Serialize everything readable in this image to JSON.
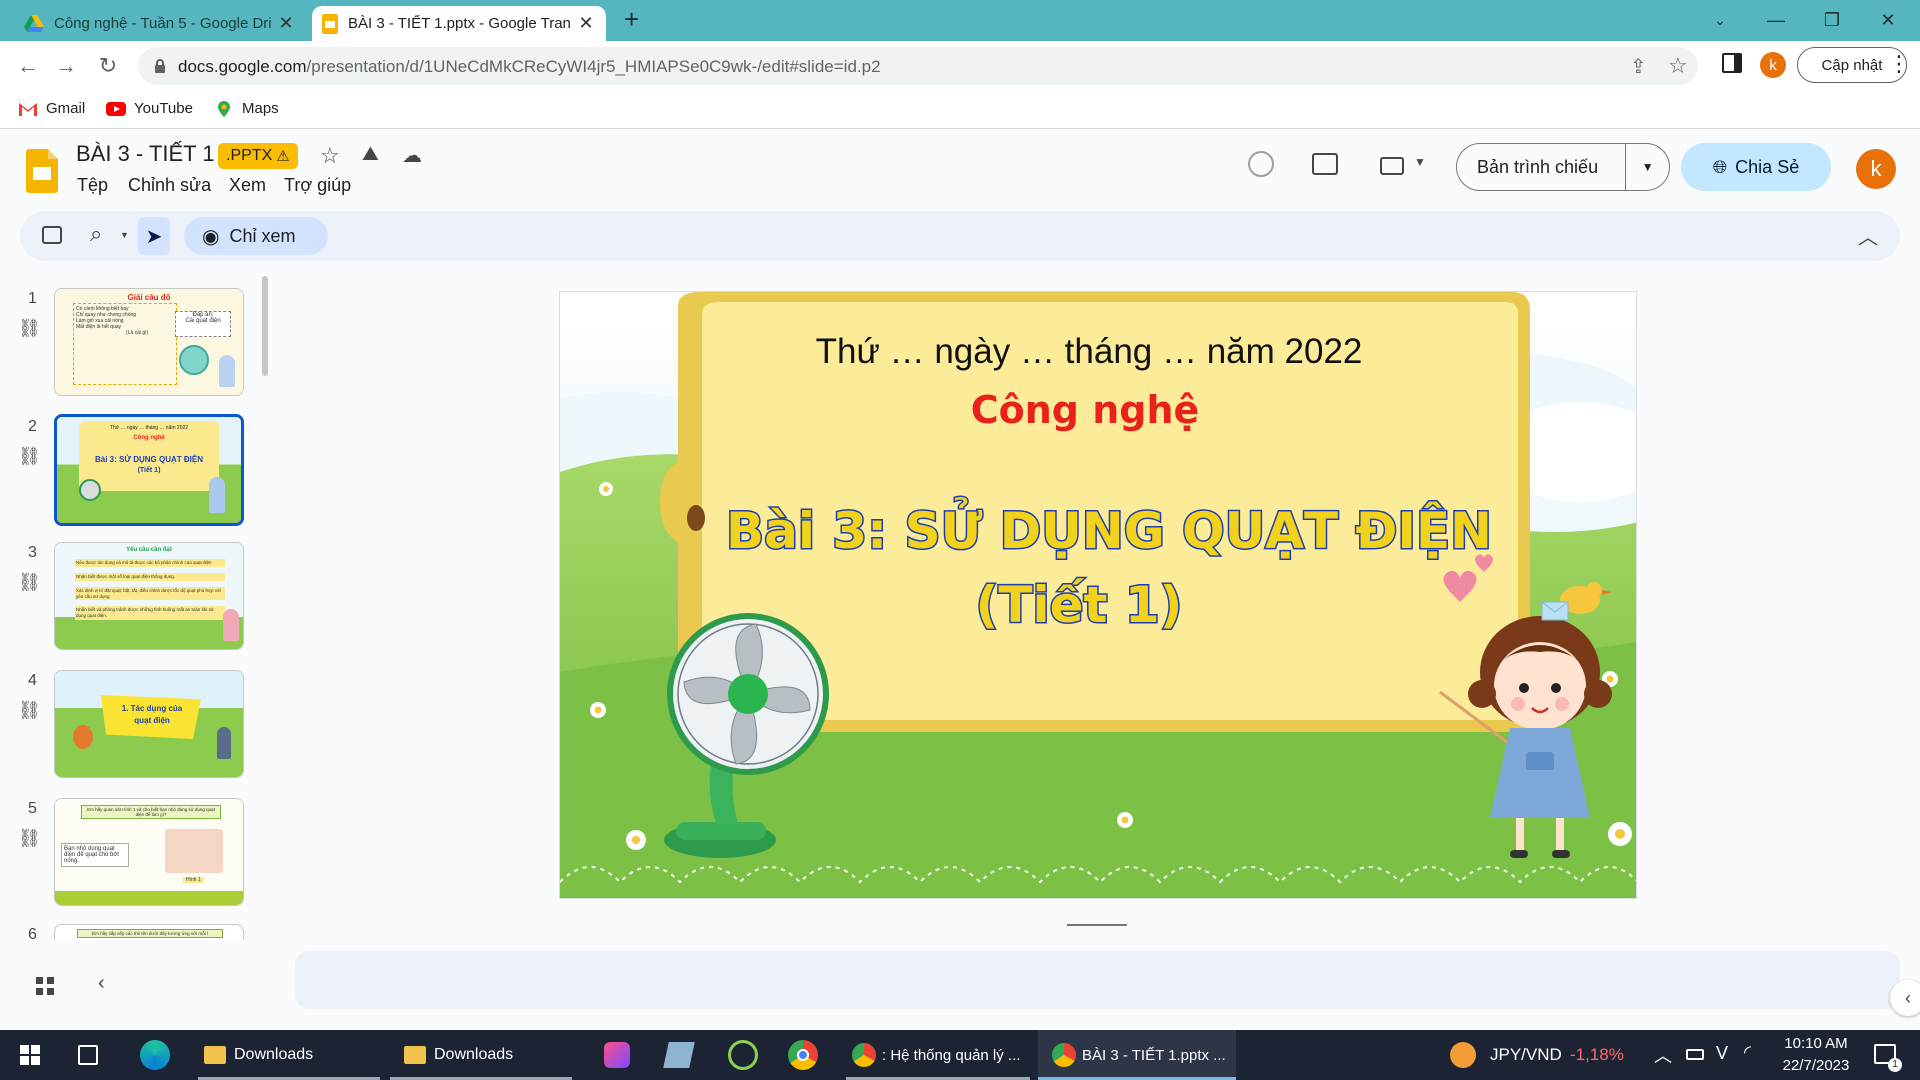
{
  "browser": {
    "tabs": [
      {
        "title": "Công nghệ - Tuần 5 - Google Dri",
        "icon": "google-drive-icon",
        "active": false
      },
      {
        "title": "BÀI 3 - TIẾT 1.pptx - Google Tran",
        "icon": "google-slides-icon",
        "active": true
      }
    ],
    "new_tab": "+",
    "url_host": "docs.google.com",
    "url_path": "/presentation/d/1UNeCdMkCReCyWI4jr5_HMIAPSe0C9wk-/edit#slide=id.p2",
    "profile_initial": "k",
    "update_label": "Cập nhật",
    "bookmarks": [
      "Gmail",
      "YouTube",
      "Maps"
    ]
  },
  "app": {
    "doc_title": "BÀI 3 - TIẾT 1",
    "badge": ".PPTX",
    "menu": [
      "Tệp",
      "Chỉnh sửa",
      "Xem",
      "Trợ giúp"
    ],
    "present_label": "Bản trình chiếu",
    "share_label": "Chia Sẻ",
    "avatar_initial": "k",
    "view_only_label": "Chỉ xem"
  },
  "filmstrip": {
    "thumbs": [
      {
        "num": "1",
        "title": "Giải câu đố",
        "lines": [
          "Có cánh không biết bay",
          "Chỉ quay như chong chóng",
          "Làm gió xua cái nóng",
          "Mất điện là hết quay",
          "(Là cái gì)"
        ],
        "answer_label": "Đáp án:",
        "answer": "Cái quạt điện"
      },
      {
        "num": "2",
        "top": "Thứ … ngày … tháng … năm 2022",
        "subject": "Công nghệ",
        "title": "Bài 3: SỬ DỤNG QUẠT ĐIỆN",
        "sub": "(Tiết 1)"
      },
      {
        "num": "3",
        "title": "Yêu cầu cần đạt",
        "lines": [
          "Nêu được tác dụng và mô tả được các bộ phận chính của quạt điện",
          "Nhận biết được một số loại quạt điện thông dụng.",
          "Xác định vị trí đặt quạt; bật, tắt, điều chỉnh được tốc độ quạt phù hợp với yêu cầu sử dụng.",
          "Nhận biết và phòng tránh được những tình huống mất an toàn khi sử dụng quạt điện."
        ]
      },
      {
        "num": "4",
        "title": "1. Tác dụng của quạt điện"
      },
      {
        "num": "5",
        "title": "Em hãy quan sát Hình 1 và cho biết bạn nhỏ đang sử dụng quạt điện để làm gì?",
        "caption": "Bạn nhỏ dùng quạt điện để quạt cho bớt nóng.",
        "fig": "Hình 1"
      },
      {
        "num": "6",
        "title": "Em hãy sắp xếp các thẻ tên dưới đây tương ứng với mỗi l"
      }
    ]
  },
  "slide": {
    "date_line": "Thứ … ngày … tháng … năm 2022",
    "subject": "Công nghệ",
    "title": "Bài 3: SỬ DỤNG QUẠT ĐIỆN",
    "subtitle": "(Tiết  1)"
  },
  "taskbar": {
    "items": [
      "Downloads",
      "Downloads",
      ": Hệ thống quản lý ...",
      "BÀI 3 - TIẾT 1.pptx ..."
    ],
    "currency": "JPY/VND",
    "change": "-1,18%",
    "time": "10:10 AM",
    "date": "22/7/2023"
  },
  "colors": {
    "tab_strip": "#56b6c0",
    "accent_blue": "#0b57d0",
    "share_bg": "#c2e7ff",
    "badge": "#fbbc04",
    "slide_title_blue": "#1d3fae",
    "slide_title_fill": "#f2d21a",
    "subject_red": "#e8221b",
    "grass": "#86c548",
    "taskbar": "#1c2433"
  }
}
